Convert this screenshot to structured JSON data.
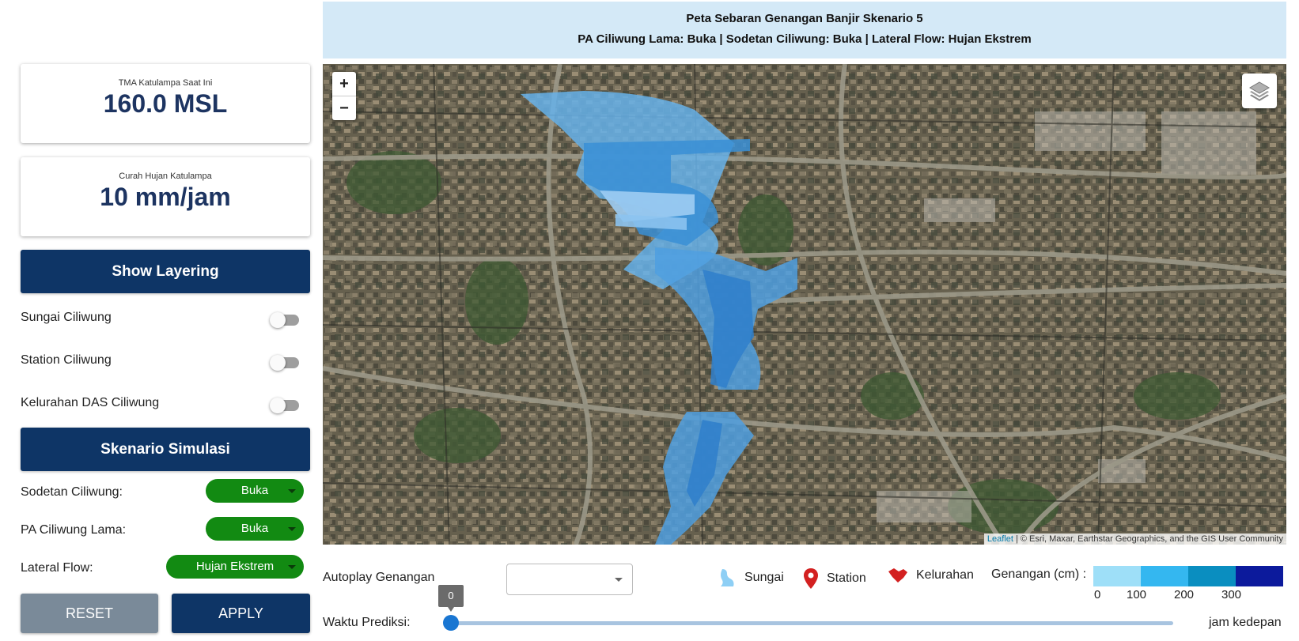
{
  "cards": {
    "tma": {
      "label": "TMA Katulampa Saat Ini",
      "value": "160.0 MSL"
    },
    "hujan": {
      "label": "Curah Hujan Katulampa",
      "value": "10 mm/jam"
    }
  },
  "layering": {
    "button_label": "Show Layering",
    "toggles": [
      {
        "label": "Sungai Ciliwung",
        "on": false
      },
      {
        "label": "Station Ciliwung",
        "on": false
      },
      {
        "label": "Kelurahan DAS Ciliwung",
        "on": false
      }
    ]
  },
  "skenario": {
    "button_label": "Skenario Simulasi",
    "selects": [
      {
        "label": "Sodetan Ciliwung:",
        "value": "Buka"
      },
      {
        "label": "PA Ciliwung Lama:",
        "value": "Buka"
      },
      {
        "label": "Lateral Flow:",
        "value": "Hujan Ekstrem"
      }
    ],
    "reset_label": "RESET",
    "apply_label": "APPLY",
    "pill_color": "#128a12"
  },
  "header": {
    "title": "Peta Sebaran Genangan Banjir Skenario 5",
    "subtitle": "PA Ciliwung Lama: Buka | Sodetan Ciliwung: Buka | Lateral Flow: Hujan Ekstrem"
  },
  "map": {
    "zoom_in": "+",
    "zoom_out": "−",
    "attribution_leaflet": "Leaflet",
    "attribution_rest": " | © Esri, Maxar, Earthstar Geographics, and the GIS User Community"
  },
  "controls": {
    "autoplay_label": "Autoplay Genangan",
    "autoplay_value": "",
    "waktu_label": "Waktu Prediksi:",
    "slider_value": "0",
    "jam_label": "jam kedepan"
  },
  "legend": {
    "sungai": "Sungai",
    "station": "Station",
    "kelurahan": "Kelurahan",
    "genangan_label": "Genangan (cm) :",
    "scale_colors": [
      "#9edff8",
      "#34b7f0",
      "#0a8ec0",
      "#0c1a9c"
    ],
    "scale_ticks": [
      "0",
      "100",
      "200",
      "300"
    ]
  }
}
